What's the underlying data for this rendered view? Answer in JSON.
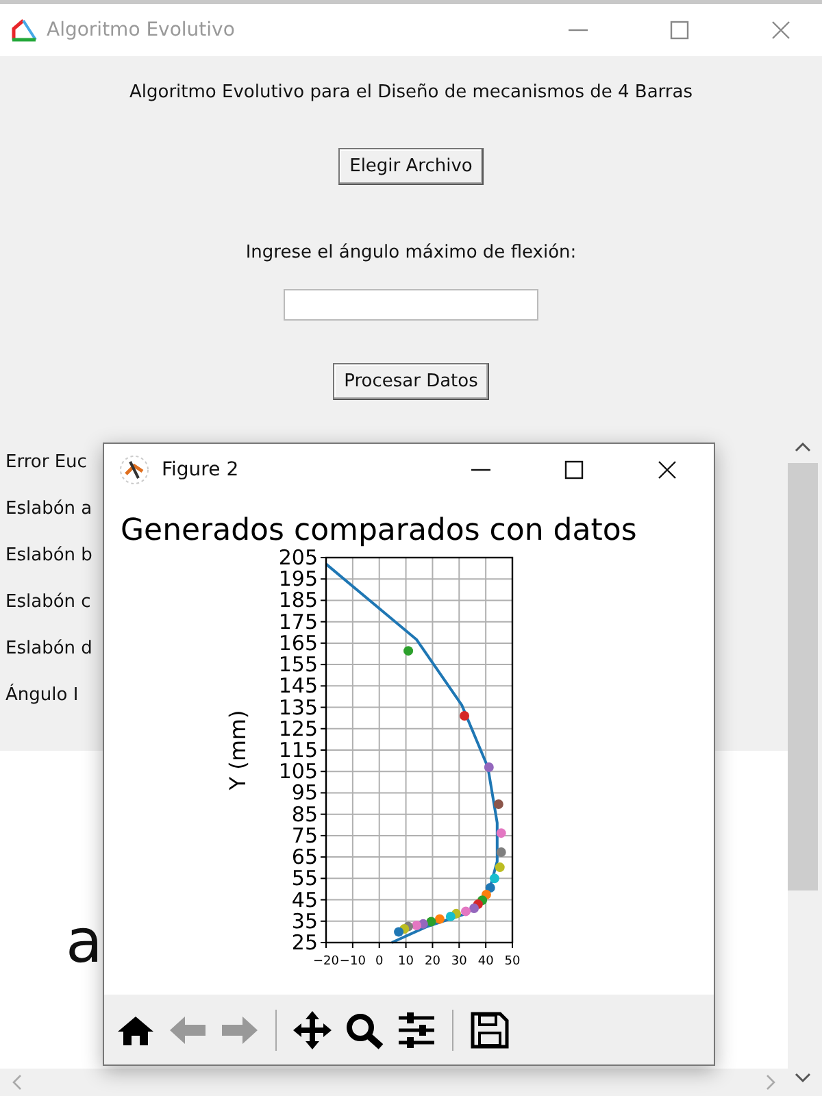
{
  "window": {
    "title": "Algoritmo Evolutivo"
  },
  "heading": "Algoritmo Evolutivo para el Diseño de mecanismos de 4 Barras",
  "file_button": "Elegir Archivo",
  "angle_prompt": "Ingrese el ángulo máximo de flexión:",
  "process_button": "Procesar Datos",
  "results": [
    "Error Euc",
    "Eslabón a",
    "Eslabón b",
    "Eslabón c",
    "Eslabón d",
    "Ángulo I"
  ],
  "canvas_text": "a",
  "figure_window": {
    "title": "Figure 2",
    "chart_data": {
      "type": "line",
      "title": "Generados comparados con datos",
      "ylabel": "Y (mm)",
      "xlim": [
        -20,
        50
      ],
      "ylim": [
        25,
        205
      ],
      "grid": true,
      "xticks": [
        -20,
        -10,
        0,
        10,
        20,
        30,
        40,
        50
      ],
      "yticks": [
        25,
        35,
        45,
        55,
        65,
        75,
        85,
        95,
        105,
        115,
        125,
        135,
        145,
        155,
        165,
        175,
        185,
        195,
        205
      ],
      "series": [
        {
          "color": "#1f77b4",
          "x": [
            -20,
            14,
            31,
            40.8,
            44.3,
            44.3,
            40.8,
            33,
            17.6,
            4.7
          ],
          "values": [
            202,
            166.6,
            136,
            107,
            81,
            63,
            47,
            38.7,
            32.3,
            25
          ]
        },
        {
          "marker": "o",
          "color": "#2ca02c",
          "x": [
            10.9
          ],
          "values": [
            161.4
          ]
        },
        {
          "marker": "o",
          "color": "#d62728",
          "x": [
            32
          ],
          "values": [
            131
          ]
        },
        {
          "marker": "o",
          "color": "#9467bd",
          "x": [
            41.2
          ],
          "values": [
            107
          ]
        },
        {
          "marker": "o",
          "color": "#8c564b",
          "x": [
            44.8
          ],
          "values": [
            89.7
          ]
        },
        {
          "marker": "o",
          "color": "#e377c2",
          "x": [
            45.8
          ],
          "values": [
            76.2
          ]
        },
        {
          "marker": "o",
          "color": "#7f7f7f",
          "x": [
            45.8
          ],
          "values": [
            67.3
          ]
        },
        {
          "marker": "o",
          "color": "#bcbd22",
          "x": [
            45.3
          ],
          "values": [
            60.2
          ]
        },
        {
          "marker": "o",
          "color": "#17becf",
          "x": [
            43.3
          ],
          "values": [
            55
          ]
        },
        {
          "marker": "o",
          "color": "#1f77b4",
          "x": [
            41.7
          ],
          "values": [
            50.6
          ]
        },
        {
          "marker": "o",
          "color": "#ff7f0e",
          "x": [
            40.2
          ],
          "values": [
            47.4
          ]
        },
        {
          "marker": "o",
          "color": "#2ca02c",
          "x": [
            38.7
          ],
          "values": [
            44.8
          ]
        },
        {
          "marker": "o",
          "color": "#d62728",
          "x": [
            37.1
          ],
          "values": [
            42.9
          ]
        },
        {
          "marker": "o",
          "color": "#9467bd",
          "x": [
            35.6
          ],
          "values": [
            41
          ]
        },
        {
          "marker": "o",
          "color": "#e377c2",
          "x": [
            32.5
          ],
          "values": [
            39.6
          ]
        },
        {
          "marker": "o",
          "color": "#bcbd22",
          "x": [
            28.9
          ],
          "values": [
            38.5
          ]
        },
        {
          "marker": "o",
          "color": "#17becf",
          "x": [
            26.8
          ],
          "values": [
            37.2
          ]
        },
        {
          "marker": "o",
          "color": "#ff7f0e",
          "x": [
            22.7
          ],
          "values": [
            36
          ]
        },
        {
          "marker": "o",
          "color": "#2ca02c",
          "x": [
            19.5
          ],
          "values": [
            34.8
          ]
        },
        {
          "marker": "o",
          "color": "#9467bd",
          "x": [
            16.5
          ],
          "values": [
            33.7
          ]
        },
        {
          "marker": "o",
          "color": "#e377c2",
          "x": [
            14
          ],
          "values": [
            33
          ]
        },
        {
          "marker": "o",
          "color": "#7f7f7f",
          "x": [
            10.9
          ],
          "values": [
            32.5
          ]
        },
        {
          "marker": "o",
          "color": "#bcbd22",
          "x": [
            9.4
          ],
          "values": [
            31.4
          ]
        },
        {
          "marker": "o",
          "color": "#1f77b4",
          "x": [
            7.3
          ],
          "values": [
            30
          ]
        }
      ]
    }
  }
}
